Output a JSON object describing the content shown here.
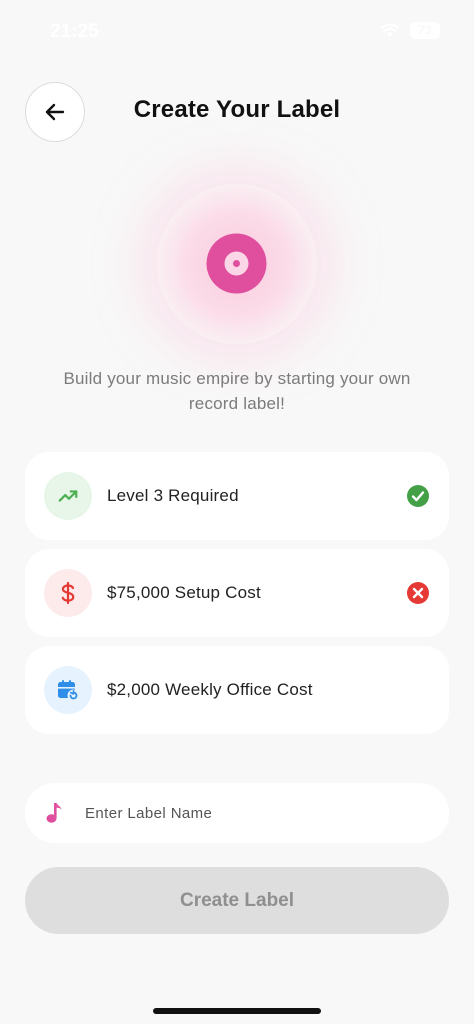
{
  "status_bar": {
    "time": "21:25",
    "battery": "73",
    "wifi_icon": "wifi-icon"
  },
  "header": {
    "title": "Create Your Label",
    "back_icon": "arrow-left-icon"
  },
  "hero": {
    "icon": "vinyl-record-icon",
    "accent_color": "#e04e9e",
    "subtitle": "Build your music empire by starting your own record label!"
  },
  "requirements": [
    {
      "label": "Level 3 Required",
      "icon": "trending-up-icon",
      "icon_color": "#4caf50",
      "icon_bg": "#e8f5e9",
      "met": true
    },
    {
      "label": "$75,000 Setup Cost",
      "icon": "dollar-icon",
      "icon_color": "#e53935",
      "icon_bg": "#fdeaea",
      "met": false
    },
    {
      "label": "$2,000 Weekly Office Cost",
      "icon": "calendar-refresh-icon",
      "icon_color": "#2f8fe8",
      "icon_bg": "#e6f2fd",
      "met": null
    }
  ],
  "label_name_field": {
    "placeholder": "Enter Label Name",
    "value": "",
    "icon": "music-note-icon"
  },
  "create_button": {
    "label": "Create Label",
    "enabled": false
  },
  "colors": {
    "success": "#43a047",
    "error": "#e53935",
    "background": "#f8f8f8"
  }
}
